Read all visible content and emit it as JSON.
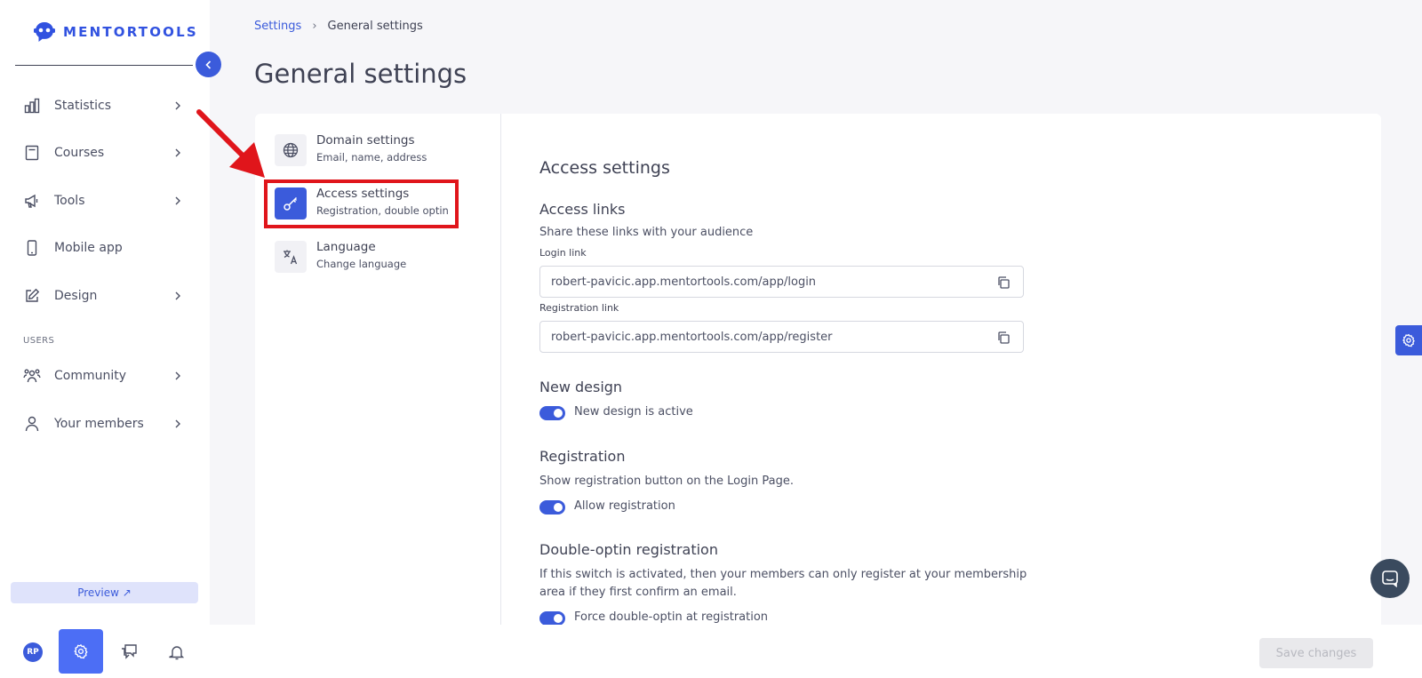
{
  "brand": {
    "name": "MENTORTOOLS"
  },
  "sidebar": {
    "items": [
      {
        "label": "Statistics",
        "icon": "bar-chart-icon"
      },
      {
        "label": "Courses",
        "icon": "book-icon"
      },
      {
        "label": "Tools",
        "icon": "megaphone-icon"
      },
      {
        "label": "Mobile app",
        "icon": "mobile-icon"
      },
      {
        "label": "Design",
        "icon": "edit-icon"
      },
      {
        "label": "Community",
        "icon": "community-icon"
      },
      {
        "label": "Your members",
        "icon": "user-icon"
      }
    ],
    "section_users": "USERS",
    "preview_label": "Preview ↗",
    "avatar_initials": "RP"
  },
  "breadcrumb": {
    "root": "Settings",
    "separator": "›",
    "current": "General settings"
  },
  "page": {
    "title": "General settings"
  },
  "settings_menu": [
    {
      "title": "Domain settings",
      "subtitle": "Email, name, address",
      "icon": "globe-icon"
    },
    {
      "title": "Access settings",
      "subtitle": "Registration, double optin",
      "icon": "key-icon"
    },
    {
      "title": "Language",
      "subtitle": "Change language",
      "icon": "translate-icon"
    }
  ],
  "access": {
    "heading": "Access settings",
    "links_heading": "Access links",
    "links_desc": "Share these links with your audience",
    "login_label": "Login link",
    "login_value": "robert-pavicic.app.mentortools.com/app/login",
    "register_label": "Registration link",
    "register_value": "robert-pavicic.app.mentortools.com/app/register",
    "new_design_heading": "New design",
    "new_design_toggle": "New design is active",
    "registration_heading": "Registration",
    "registration_desc": "Show registration button on the Login Page.",
    "registration_toggle": "Allow registration",
    "optin_heading": "Double-optin registration",
    "optin_desc_1": "If this switch is activated, then your members can only register at your membership",
    "optin_desc_2": "area if they first confirm an email.",
    "optin_toggle": "Force double-optin at registration"
  },
  "footer": {
    "save_label": "Save changes"
  },
  "colors": {
    "accent": "#3b5bdb",
    "highlight": "#e0151b"
  }
}
